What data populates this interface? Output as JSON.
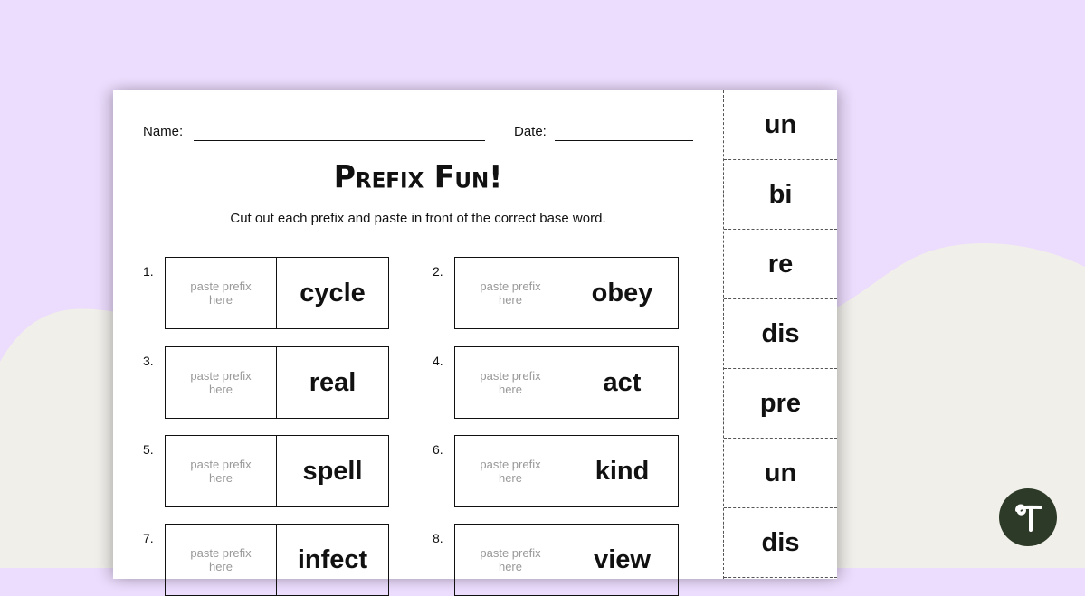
{
  "colors": {
    "background": "#ecdcfd",
    "blob": "#f1efea",
    "logo": "#2d3a27"
  },
  "worksheet": {
    "name_label": "Name:",
    "date_label": "Date:",
    "title": "Prefix Fun!",
    "instructions": "Cut out each prefix and paste in front of the correct base word.",
    "paste_placeholder_line1": "paste prefix",
    "paste_placeholder_line2": "here",
    "questions": [
      {
        "number": "1.",
        "word": "cycle"
      },
      {
        "number": "2.",
        "word": "obey"
      },
      {
        "number": "3.",
        "word": "real"
      },
      {
        "number": "4.",
        "word": "act"
      },
      {
        "number": "5.",
        "word": "spell"
      },
      {
        "number": "6.",
        "word": "kind"
      },
      {
        "number": "7.",
        "word": "infect"
      },
      {
        "number": "8.",
        "word": "view"
      }
    ],
    "prefix_cards": [
      "un",
      "bi",
      "re",
      "dis",
      "pre",
      "un",
      "dis"
    ]
  },
  "logo": {
    "icon": "brand-logo-icon"
  }
}
